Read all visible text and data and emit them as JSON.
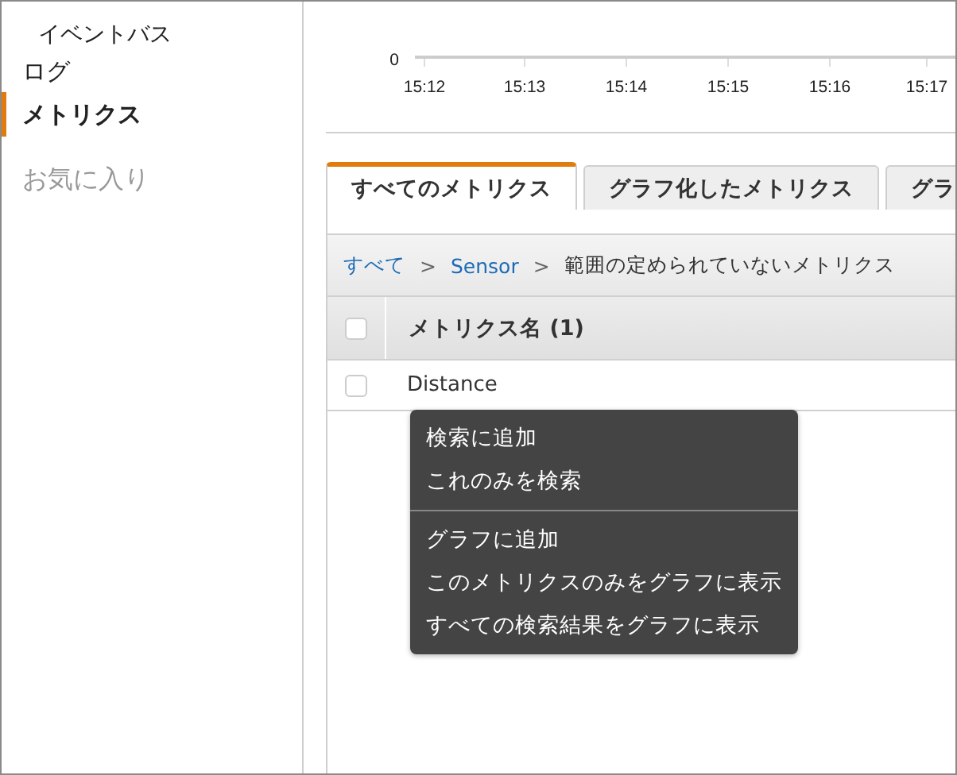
{
  "sidebar": {
    "items": [
      {
        "label": "イベントバス",
        "kind": "sub",
        "selected": false
      },
      {
        "label": "ログ",
        "kind": "main",
        "selected": false
      },
      {
        "label": "メトリクス",
        "kind": "main",
        "selected": true
      },
      {
        "label": "お気に入り",
        "kind": "heading",
        "selected": false
      }
    ]
  },
  "chart": {
    "y_tick": "0",
    "x_ticks": [
      "15:12",
      "15:13",
      "15:14",
      "15:15",
      "15:16",
      "15:17"
    ]
  },
  "tabs": [
    {
      "label": "すべてのメトリクス",
      "selected": true
    },
    {
      "label": "グラフ化したメトリクス",
      "selected": false
    },
    {
      "label": "グラ",
      "selected": false
    }
  ],
  "breadcrumb": {
    "separator": ">",
    "items": [
      {
        "label": "すべて",
        "kind": "link"
      },
      {
        "label": "Sensor",
        "kind": "link"
      },
      {
        "label": "範囲の定められていないメトリクス",
        "kind": "current"
      }
    ]
  },
  "table": {
    "select_all_checked": false,
    "columns": [
      "メトリクス名 (1)"
    ],
    "rows": [
      {
        "checked": false,
        "cells": [
          "Distance"
        ]
      }
    ]
  },
  "context_menu": {
    "groups": [
      [
        "検索に追加",
        "これのみを検索"
      ],
      [
        "グラフに追加",
        "このメトリクスのみをグラフに表示",
        "すべての検索結果をグラフに表示"
      ]
    ]
  }
}
